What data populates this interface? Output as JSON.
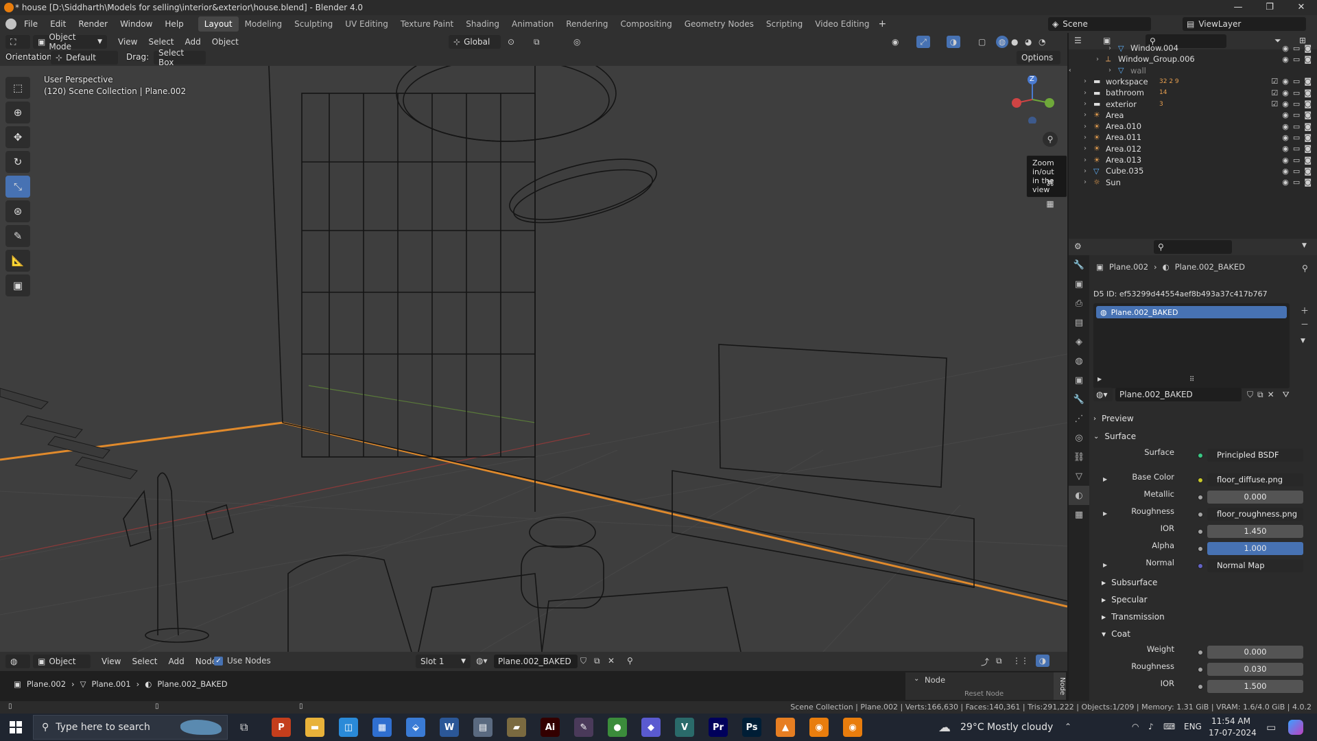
{
  "window": {
    "title": "* house [D:\\Siddharth\\Models for selling\\interior&exterior\\house.blend] - Blender 4.0",
    "controls": {
      "minimize": "—",
      "maximize": "❐",
      "close": "✕"
    }
  },
  "topbar": {
    "menus": [
      "File",
      "Edit",
      "Render",
      "Window",
      "Help"
    ],
    "workspaces": [
      "Layout",
      "Modeling",
      "Sculpting",
      "UV Editing",
      "Texture Paint",
      "Shading",
      "Animation",
      "Rendering",
      "Compositing",
      "Geometry Nodes",
      "Scripting",
      "Video Editing"
    ],
    "active_workspace": "Layout",
    "add_tab": "+",
    "scene": "Scene",
    "view_layer": "ViewLayer"
  },
  "viewport_header": {
    "mode": "Object Mode",
    "menus": [
      "View",
      "Select",
      "Add",
      "Object"
    ],
    "transform_orientation": "Global",
    "orientation_label": "Orientation:",
    "orientation_value": "Default",
    "drag_label": "Drag:",
    "drag_value": "Select Box",
    "options": "Options"
  },
  "viewport": {
    "perspective": "User Perspective",
    "collection_info": "(120) Scene Collection | Plane.002",
    "tooltip": "Zoom in/out in the view",
    "gizmo_axis": "Z",
    "tools": [
      "select-box",
      "cursor",
      "move",
      "rotate",
      "scale",
      "transform",
      "annotate",
      "measure",
      "add-cube"
    ],
    "active_tool": "scale"
  },
  "outliner": {
    "rows": [
      {
        "name": "Window.004",
        "indent": 3,
        "kind": "mesh"
      },
      {
        "name": "Window_Group.006",
        "indent": 2,
        "kind": "empty"
      },
      {
        "name": "wall",
        "indent": 3,
        "kind": "mesh",
        "dim": true
      },
      {
        "name": "workspace",
        "indent": 1,
        "kind": "collection",
        "badge": "32 2 9"
      },
      {
        "name": "bathroom",
        "indent": 1,
        "kind": "collection",
        "badge": "14"
      },
      {
        "name": "exterior",
        "indent": 1,
        "kind": "collection",
        "badge": "3"
      },
      {
        "name": "Area",
        "indent": 1,
        "kind": "light"
      },
      {
        "name": "Area.010",
        "indent": 1,
        "kind": "light"
      },
      {
        "name": "Area.011",
        "indent": 1,
        "kind": "light"
      },
      {
        "name": "Area.012",
        "indent": 1,
        "kind": "light"
      },
      {
        "name": "Area.013",
        "indent": 1,
        "kind": "light"
      },
      {
        "name": "Cube.035",
        "indent": 1,
        "kind": "mesh"
      },
      {
        "name": "Sun",
        "indent": 1,
        "kind": "sun"
      }
    ]
  },
  "properties": {
    "breadcrumb_object": "Plane.002",
    "breadcrumb_material": "Plane.002_BAKED",
    "d5_id": "D5 ID: ef53299d44554aef8b493a37c417b767",
    "slot_item": "Plane.002_BAKED",
    "material_name": "Plane.002_BAKED",
    "sections": {
      "preview": "Preview",
      "surface": "Surface",
      "subsurface": "Subsurface",
      "specular": "Specular",
      "transmission": "Transmission",
      "coat": "Coat"
    },
    "rows": {
      "surface": {
        "label": "Surface",
        "value": "Principled BSDF"
      },
      "base_color": {
        "label": "Base Color",
        "value": "floor_diffuse.png"
      },
      "metallic": {
        "label": "Metallic",
        "value": "0.000"
      },
      "roughness": {
        "label": "Roughness",
        "value": "floor_roughness.png"
      },
      "ior": {
        "label": "IOR",
        "value": "1.450"
      },
      "alpha": {
        "label": "Alpha",
        "value": "1.000"
      },
      "normal": {
        "label": "Normal",
        "value": "Normal Map"
      },
      "coat_weight": {
        "label": "Weight",
        "value": "0.000"
      },
      "coat_roughness": {
        "label": "Roughness",
        "value": "0.030"
      },
      "coat_ior": {
        "label": "IOR",
        "value": "1.500"
      }
    }
  },
  "node_editor": {
    "mode": "Object",
    "menus": [
      "View",
      "Select",
      "Add",
      "Node"
    ],
    "use_nodes": "Use Nodes",
    "slot": "Slot 1",
    "material": "Plane.002_BAKED",
    "breadcrumb": [
      "Plane.002",
      "Plane.001",
      "Plane.002_BAKED"
    ],
    "side_panel_header": "Node",
    "side_panel_tab": "Node",
    "reset_node": "Reset Node"
  },
  "statusbar": {
    "text": "Scene Collection | Plane.002 | Verts:166,630 | Faces:140,361 | Tris:291,222 | Objects:1/209 | Memory: 1.31 GiB | VRAM: 1.6/4.0 GiB | 4.0.2"
  },
  "taskbar": {
    "search_placeholder": "Type here to search",
    "weather": "29°C  Mostly cloudy",
    "lang": "ENG",
    "time": "11:54 AM",
    "date": "17-07-2024",
    "apps": [
      {
        "label": "P",
        "color": "#c43e1c"
      },
      {
        "label": "▬",
        "color": "#e8b23a"
      },
      {
        "label": "◫",
        "color": "#2a8ad8"
      },
      {
        "label": "▦",
        "color": "#2f6fd0"
      },
      {
        "label": "⬙",
        "color": "#3a7bd5"
      },
      {
        "label": "W",
        "color": "#2b5797"
      },
      {
        "label": "▤",
        "color": "#5a6a80"
      },
      {
        "label": "▰",
        "color": "#7a6a40"
      },
      {
        "label": "Ai",
        "color": "#330000"
      },
      {
        "label": "✎",
        "color": "#4a3a5a"
      },
      {
        "label": "●",
        "color": "#3b8c3b"
      },
      {
        "label": "◆",
        "color": "#5a5ad0"
      },
      {
        "label": "V",
        "color": "#2a6a6a"
      },
      {
        "label": "Pr",
        "color": "#00005b"
      },
      {
        "label": "Ps",
        "color": "#001e36"
      },
      {
        "label": "▲",
        "color": "#e67e22"
      },
      {
        "label": "◉",
        "color": "#e87d0d"
      },
      {
        "label": "◉",
        "color": "#e87d0d"
      }
    ]
  }
}
